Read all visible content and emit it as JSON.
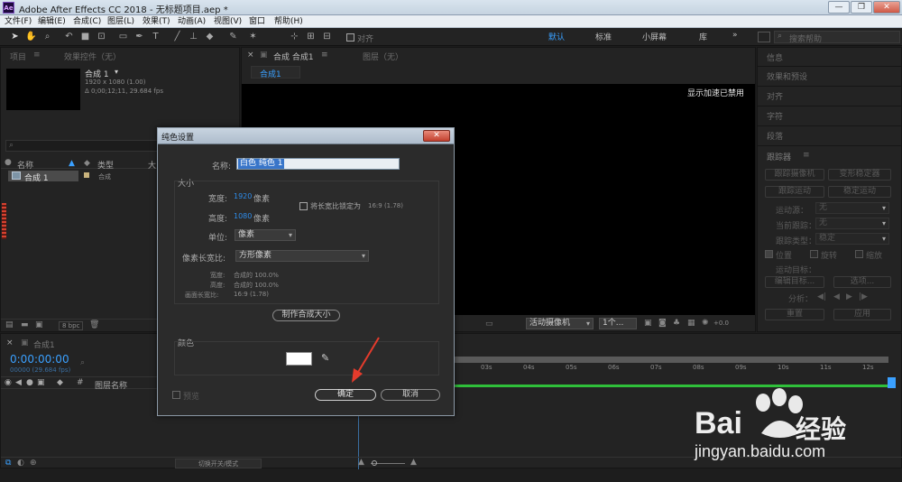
{
  "window": {
    "title": "Adobe After Effects CC 2018 - 无标题项目.aep *",
    "icon": "Ae"
  },
  "menu": [
    "文件(F)",
    "编辑(E)",
    "合成(C)",
    "图层(L)",
    "效果(T)",
    "动画(A)",
    "视图(V)",
    "窗口",
    "帮助(H)"
  ],
  "toolbar": {
    "align_label": "对齐",
    "workspaces": [
      "默认",
      "标准",
      "小屏幕",
      "库"
    ],
    "search_placeholder": "搜索帮助"
  },
  "project_panel": {
    "tab_project": "项目",
    "tab_effects": "效果控件（无）",
    "comp_name": "合成 1",
    "comp_info": "1920 x 1080 (1.00)",
    "comp_duration": "Δ 0;00;12;11, 29.684 fps",
    "col_name": "名称",
    "col_type": "类型",
    "col_size": "大",
    "row_name": "合成 1",
    "row_type": "合成",
    "bpc": "8 bpc"
  },
  "composition_panel": {
    "tab": "合成 合成1",
    "layer_tab": "图层（无）",
    "subtab": "合成1",
    "accel_notice": "显示加速已禁用",
    "camera": "活动摄像机",
    "view": "1个...",
    "exposure": "+0.0"
  },
  "right_panel": {
    "items": [
      "信息",
      "效果和预设",
      "对齐",
      "字符",
      "段落"
    ],
    "tracker_title": "跟踪器",
    "btn_track_camera": "跟踪摄像机",
    "btn_warp_stabilizer": "变形稳定器",
    "btn_track_motion": "跟踪运动",
    "btn_stabilize_motion": "稳定运动",
    "motion_source_label": "运动源：",
    "motion_source_value": "无",
    "current_track_label": "当前跟踪：",
    "current_track_value": "无",
    "track_type_label": "跟踪类型：",
    "track_type_value": "稳定",
    "chk_position": "位置",
    "chk_rotation": "旋转",
    "chk_scale": "缩放",
    "motion_target": "运动目标：",
    "btn_edit_target": "编辑目标...",
    "btn_options": "选项...",
    "analyze_label": "分析：",
    "btn_reset": "重置",
    "btn_apply": "应用"
  },
  "timeline": {
    "tab": "合成1",
    "timecode": "0:00:00:00",
    "frames": "00000 (29.684 fps)",
    "col_layer_name": "图层名称",
    "ruler": [
      "03s",
      "04s",
      "05s",
      "06s",
      "07s",
      "08s",
      "09s",
      "10s",
      "11s",
      "12s"
    ],
    "toggle_label": "切换开关/模式"
  },
  "dialog": {
    "title": "纯色设置",
    "name_label": "名称:",
    "name_value": "白色 纯色 1",
    "size_group": "大小",
    "width_label": "宽度:",
    "width_value": "1920",
    "height_label": "高度:",
    "height_value": "1080",
    "px_unit": "像素",
    "lock_label": "将长宽比锁定为",
    "lock_ratio": "16:9 (1.78)",
    "units_label": "单位:",
    "units_value": "像素",
    "par_label": "像素长宽比:",
    "par_value": "方形像素",
    "info_width_label": "宽度:",
    "info_width_value": "合成的 100.0%",
    "info_height_label": "高度:",
    "info_height_value": "合成的 100.0%",
    "info_frame_label": "画面长宽比:",
    "info_frame_value": "16:9 (1.78)",
    "make_comp_size": "制作合成大小",
    "color_group": "颜色",
    "color_value": "#ffffff",
    "preview_label": "预览",
    "ok_label": "确定",
    "cancel_label": "取消"
  },
  "watermark": {
    "brand": "Bai",
    "brand2": "经验",
    "url": "jingyan.baidu.com"
  },
  "colors": {
    "accent_blue": "#2d8ceb",
    "arrow_red": "#e53b2c",
    "timeline_green": "#2fbf3a"
  }
}
